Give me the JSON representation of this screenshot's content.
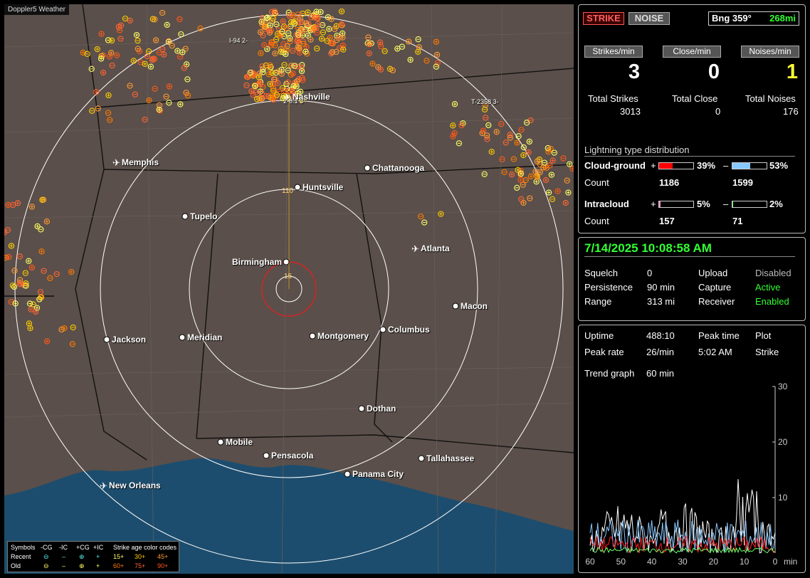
{
  "app": {
    "badge": "Doppler5 Weather"
  },
  "map": {
    "cities": [
      {
        "name": "Nashville",
        "marker": "plane"
      },
      {
        "name": "Memphis",
        "marker": "plane"
      },
      {
        "name": "Chattanooga",
        "marker": "dot"
      },
      {
        "name": "Huntsville",
        "marker": "dot"
      },
      {
        "name": "Tupelo",
        "marker": "dot"
      },
      {
        "name": "Atlanta",
        "marker": "plane"
      },
      {
        "name": "Birmingham",
        "marker": "dot"
      },
      {
        "name": "Macon",
        "marker": "dot"
      },
      {
        "name": "Jackson",
        "marker": "dot"
      },
      {
        "name": "Meridian",
        "marker": "dot"
      },
      {
        "name": "Montgomery",
        "marker": "dot"
      },
      {
        "name": "Columbus",
        "marker": "dot"
      },
      {
        "name": "Dothan",
        "marker": "dot"
      },
      {
        "name": "Mobile",
        "marker": "dot"
      },
      {
        "name": "Pensacola",
        "marker": "dot"
      },
      {
        "name": "Tallahassee",
        "marker": "dot"
      },
      {
        "name": "Panama City",
        "marker": "dot"
      },
      {
        "name": "New Orleans",
        "marker": "plane"
      }
    ],
    "road_labels": [
      "I-94 2-",
      "T-2358 3-",
      "2-8.1 3"
    ],
    "range_labels": [
      "110",
      "15"
    ],
    "legend": {
      "header": [
        "Symbols",
        "-CG",
        "-IC",
        "+CG",
        "+IC",
        "Strike age color codes"
      ],
      "recent": {
        "label": "Recent",
        "ages": [
          "15+",
          "30+",
          "45+"
        ]
      },
      "old": {
        "label": "Old",
        "ages": [
          "60+",
          "75+",
          "90+"
        ]
      },
      "age_colors": [
        "#ffff66",
        "#ffcc00",
        "#ff9933",
        "#ff7a00",
        "#ff6633",
        "#ff5a1a"
      ]
    }
  },
  "panel_top": {
    "strike_button": "STRIKE",
    "noise_button": "NOISE",
    "bearing_label": "Bng 359°",
    "distance": "268mi",
    "rate_buttons": [
      "Strikes/min",
      "Close/min",
      "Noises/min"
    ],
    "rates": {
      "strikes": "3",
      "close": "0",
      "noises": "1"
    },
    "totals_labels": [
      "Total Strikes",
      "Total Close",
      "Total Noises"
    ],
    "totals": {
      "strikes": "3013",
      "close": "0",
      "noises": "176"
    },
    "distribution_title": "Lightning type distribution",
    "cloud_ground": {
      "label": "Cloud-ground",
      "pos_sign": "+",
      "pos_pct": "39%",
      "pos_value": 39,
      "pos_color": "#ff0000",
      "neg_sign": "–",
      "neg_pct": "53%",
      "neg_value": 53,
      "neg_color": "#88c8ff",
      "count_label": "Count",
      "pos_count": "1186",
      "neg_count": "1599"
    },
    "intracloud": {
      "label": "Intracloud",
      "pos_sign": "+",
      "pos_pct": "5%",
      "pos_value": 5,
      "pos_color": "#ff88cc",
      "neg_sign": "–",
      "neg_pct": "2%",
      "neg_value": 2,
      "neg_color": "#66ff66",
      "count_label": "Count",
      "pos_count": "157",
      "neg_count": "71"
    }
  },
  "panel_status": {
    "datetime": "7/14/2025 10:08:58 AM",
    "rows": [
      {
        "k1": "Squelch",
        "v1": "0",
        "k2": "Upload",
        "v2": "Disabled",
        "v2_color": "#bbbbbb"
      },
      {
        "k1": "Persistence",
        "v1": "90 min",
        "k2": "Capture",
        "v2": "Active",
        "v2_color": "#33ff33"
      },
      {
        "k1": "Range",
        "v1": "313 mi",
        "k2": "Receiver",
        "v2": "Enabled",
        "v2_color": "#33ff33"
      }
    ]
  },
  "panel_trend": {
    "uptime_label": "Uptime",
    "uptime": "488:10",
    "peak_time_label": "Peak time",
    "plot_label": "Plot",
    "peak_rate_label": "Peak rate",
    "peak_rate": "26/min",
    "peak_time": "5:02 AM",
    "plot_value": "Strike",
    "trend_label": "Trend graph",
    "trend_value": "60 min",
    "chart_data": {
      "type": "line",
      "x_ticks": [
        "60",
        "50",
        "40",
        "30",
        "20",
        "10",
        "0"
      ],
      "x_unit": "min",
      "y_ticks": [
        "30",
        "20",
        "10"
      ],
      "ylim": [
        0,
        30
      ],
      "xlim": [
        60,
        0
      ]
    }
  }
}
